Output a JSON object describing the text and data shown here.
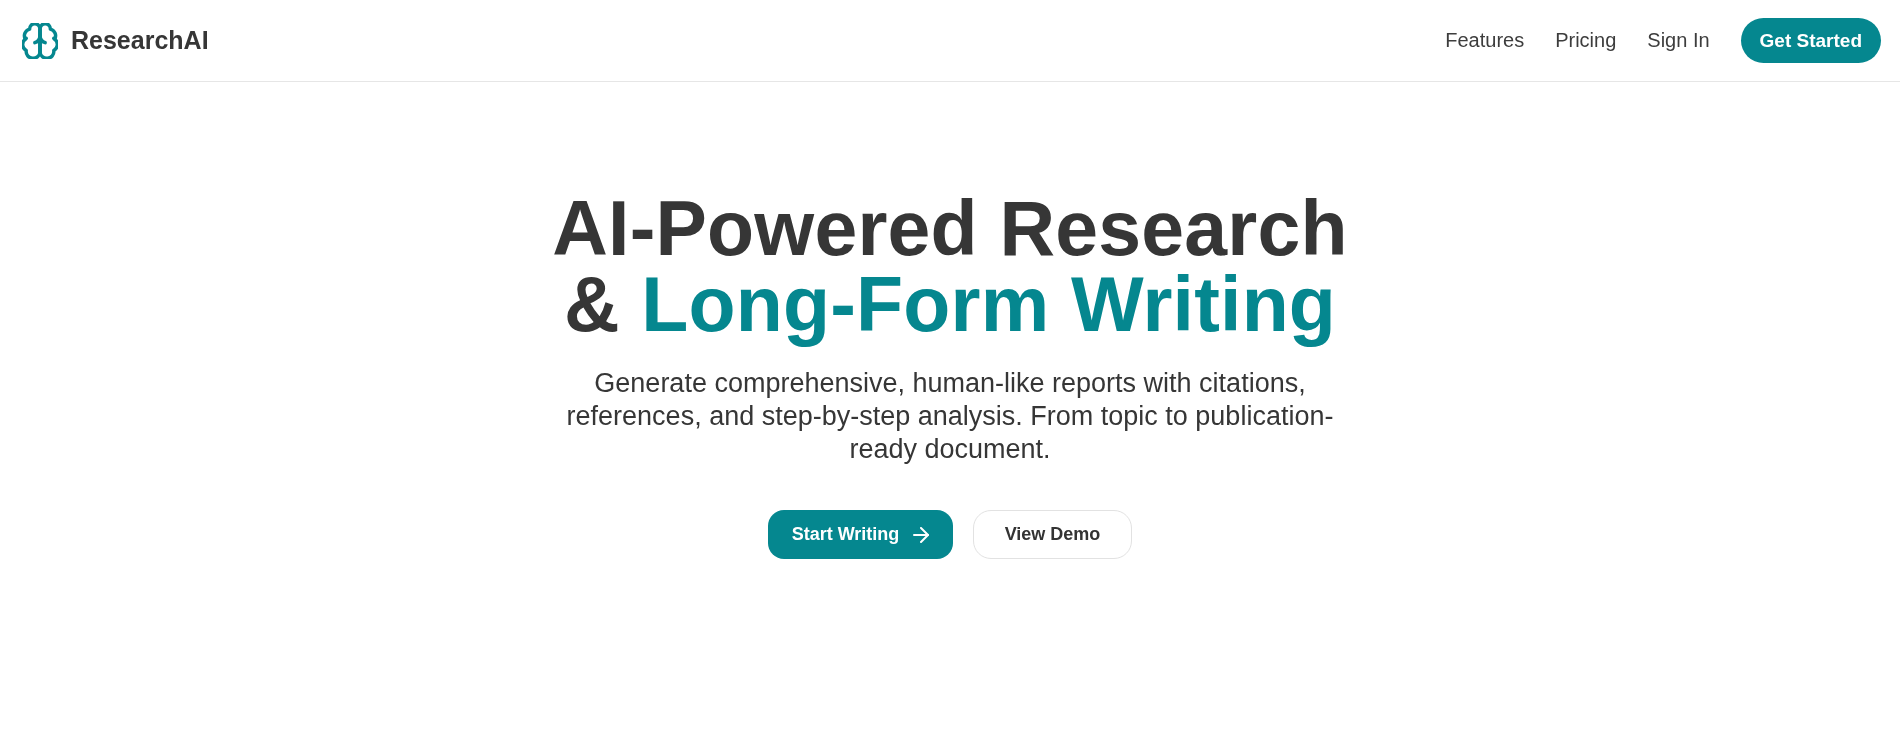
{
  "brand": {
    "name": "ResearchAI"
  },
  "nav": {
    "links": [
      "Features",
      "Pricing",
      "Sign In"
    ],
    "cta": "Get Started"
  },
  "hero": {
    "heading": {
      "text": "AI-Powered Research",
      "connector": "&",
      "highlight": "Long-Form Writing"
    },
    "subtitle": "Generate comprehensive, human-like reports with citations, references, and step-by-step analysis. From topic to publication-ready document.",
    "actions": [
      {
        "label": "Start Writing",
        "kind": "primary"
      },
      {
        "label": "View Demo",
        "kind": "secondary"
      }
    ]
  }
}
